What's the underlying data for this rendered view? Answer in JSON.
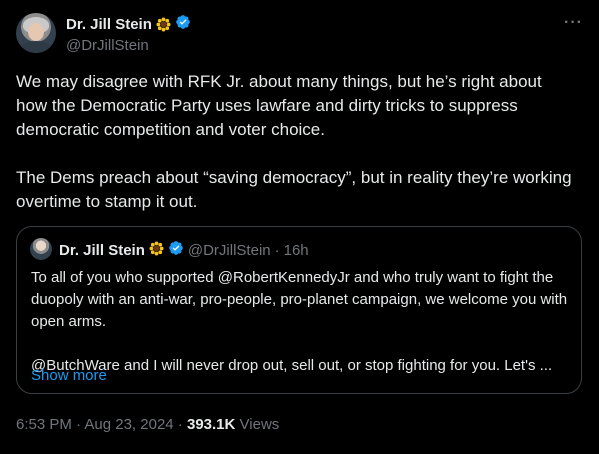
{
  "author": {
    "name": "Dr. Jill Stein",
    "handle": "@DrJillStein",
    "name_emoji_icon": "sunflower-icon",
    "verified_icon": "verified-badge-icon"
  },
  "tweet": {
    "paragraphs": [
      "We may disagree with RFK Jr. about many things, but he’s right about how the Democratic Party uses lawfare and dirty tricks to suppress democratic competition and voter choice.",
      "The Dems preach about “saving democracy”, but in reality they’re working overtime to stamp it out."
    ]
  },
  "quote": {
    "name": "Dr. Jill Stein",
    "handle": "@DrJillStein",
    "separator": "·",
    "age": "16h",
    "paragraphs": [
      "To all of you who supported @RobertKennedyJr  and who truly want to fight the duopoly with an anti-war, pro-people, pro-planet campaign, we welcome you with open arms.",
      "@ButchWare and I will never drop out, sell out, or stop fighting for you. Let's ..."
    ],
    "show_more_label": "Show more"
  },
  "footer": {
    "time": "6:53 PM",
    "dot1": "·",
    "date": "Aug 23, 2024",
    "dot2": "·",
    "views_count": "393.1K",
    "views_label": "Views"
  },
  "colors": {
    "background": "#000000",
    "text": "#e7e9ea",
    "secondary": "#71767b",
    "link": "#1d9bf0",
    "verified": "#1d9bf0",
    "border": "#3a3f44"
  },
  "more_icon": "more-dots-icon"
}
